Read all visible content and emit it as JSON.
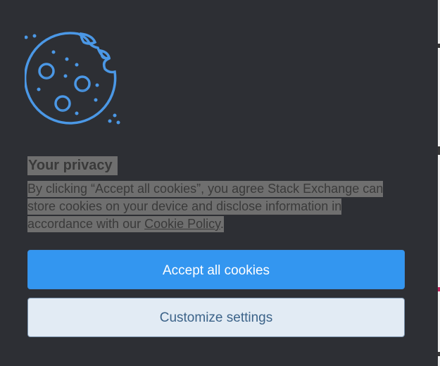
{
  "icons": {
    "cookie": "cookie-icon"
  },
  "colors": {
    "background": "#2d2f34",
    "accent": "#3396f0",
    "icon": "#4b98e6",
    "secondary_button_bg": "#e2ebf4",
    "secondary_button_text": "#3c6389"
  },
  "privacy": {
    "title": "Your privacy",
    "text_before_link": "By clicking “Accept all cookies”, you agree Stack Exchange can store cookies on your device and disclose information in accordance with our ",
    "link_label": "Cookie Policy",
    "text_after_link": "."
  },
  "buttons": {
    "accept_label": "Accept all cookies",
    "customize_label": "Customize settings"
  }
}
